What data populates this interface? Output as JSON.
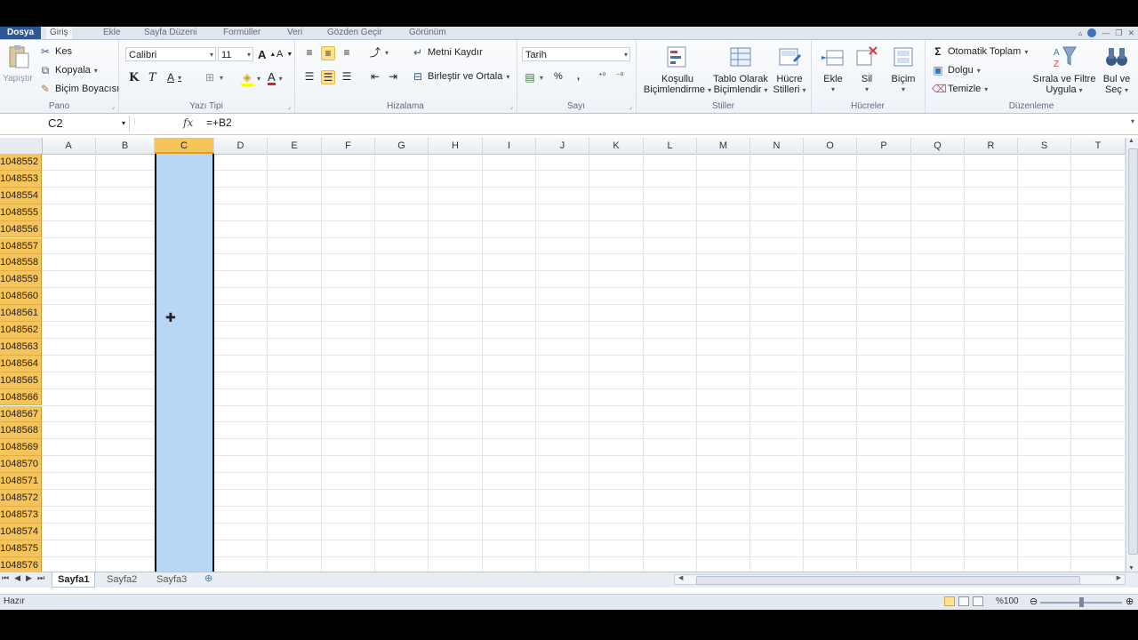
{
  "tabs": {
    "file": "Dosya",
    "items": [
      "Giriş",
      "Ekle",
      "Sayfa Düzeni",
      "Formüller",
      "Veri",
      "Gözden Geçir",
      "Görünüm"
    ],
    "active_index": 0
  },
  "ribbon": {
    "pano": {
      "label": "Pano",
      "paste": "Yapıştır",
      "cut": "Kes",
      "copy": "Kopyala",
      "format_painter": "Biçim Boyacısı"
    },
    "font": {
      "label": "Yazı Tipi",
      "name": "Calibri",
      "size": "11",
      "bold": "K",
      "italic": "T",
      "underline": "A",
      "grow": "A",
      "shrink": "A",
      "font_color_letter": "A"
    },
    "alignment": {
      "label": "Hizalama",
      "wrap": "Metni Kaydır",
      "merge": "Birleştir ve Ortala"
    },
    "number": {
      "label": "Sayı",
      "format": "Tarih",
      "percent": "%",
      "comma": ","
    },
    "styles": {
      "label": "Stiller",
      "conditional_1": "Koşullu",
      "conditional_2": "Biçimlendirme",
      "table_1": "Tablo Olarak",
      "table_2": "Biçimlendir",
      "cell_1": "Hücre",
      "cell_2": "Stilleri"
    },
    "cells": {
      "label": "Hücreler",
      "insert": "Ekle",
      "delete": "Sil",
      "format": "Biçim"
    },
    "editing": {
      "label": "Düzenleme",
      "autosum": "Otomatik Toplam",
      "fill": "Dolgu",
      "clear": "Temizle",
      "sort_1": "Sırala ve Filtre",
      "sort_2": "Uygula",
      "find_1": "Bul ve",
      "find_2": "Seç"
    }
  },
  "formula_bar": {
    "name_box": "C2",
    "fx": "fx",
    "formula": "=+B2"
  },
  "grid": {
    "columns": [
      "A",
      "B",
      "C",
      "D",
      "E",
      "F",
      "G",
      "H",
      "I",
      "J",
      "K",
      "L",
      "M",
      "N",
      "O",
      "P",
      "Q",
      "R",
      "S",
      "T"
    ],
    "selected_column": "C",
    "rows": [
      "1048552",
      "1048553",
      "1048554",
      "1048555",
      "1048556",
      "1048557",
      "1048558",
      "1048559",
      "1048560",
      "1048561",
      "1048562",
      "1048563",
      "1048564",
      "1048565",
      "1048566",
      "1048567",
      "1048568",
      "1048569",
      "1048570",
      "1048571",
      "1048572",
      "1048573",
      "1048574",
      "1048575",
      "1048576"
    ]
  },
  "sheets": {
    "tabs": [
      "Sayfa1",
      "Sayfa2",
      "Sayfa3"
    ],
    "active_index": 0
  },
  "status": {
    "ready": "Hazır",
    "zoom": "%100"
  },
  "colors": {
    "selection_header": "#f5c45a",
    "selected_column_fill": "#b8d7f6",
    "file_tab": "#2b5797"
  }
}
